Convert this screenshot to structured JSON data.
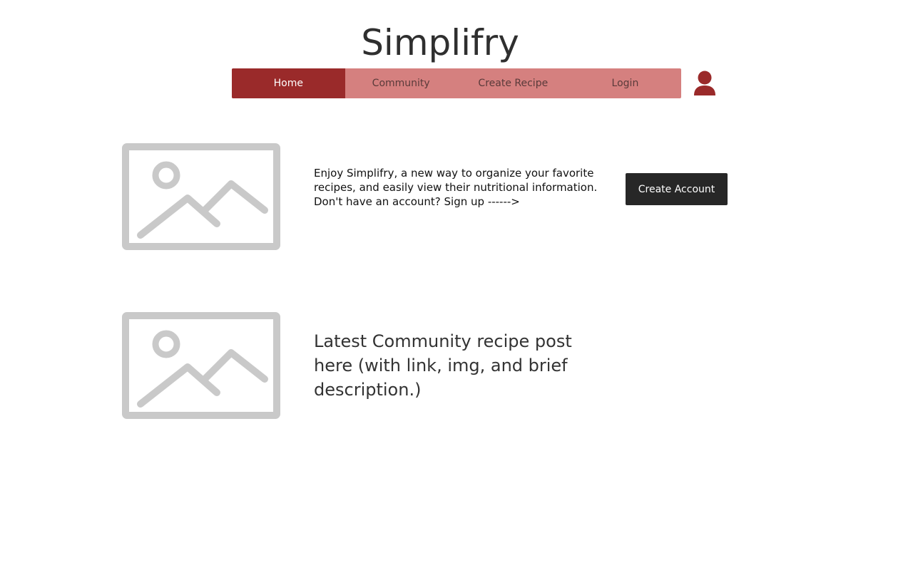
{
  "header": {
    "title": "Simplifry"
  },
  "nav": {
    "items": [
      {
        "label": "Home",
        "active": true
      },
      {
        "label": "Community",
        "active": false
      },
      {
        "label": "Create Recipe",
        "active": false
      },
      {
        "label": "Login",
        "active": false
      }
    ],
    "user_icon": "user-icon"
  },
  "intro": {
    "image_icon": "image-placeholder-icon",
    "text": "Enjoy Simplifry, a new way to organize your favorite recipes, and easily view their nutritional information. Don't have an account?  Sign up ------>",
    "button_label": "Create Account"
  },
  "latest": {
    "image_icon": "image-placeholder-icon",
    "text": "Latest Community recipe post here (with link, img, and brief description.)"
  },
  "colors": {
    "nav_bg": "#d5807f",
    "nav_active": "#9a2a2a",
    "button_bg": "#272727",
    "placeholder_gray": "#c9c9c9"
  }
}
